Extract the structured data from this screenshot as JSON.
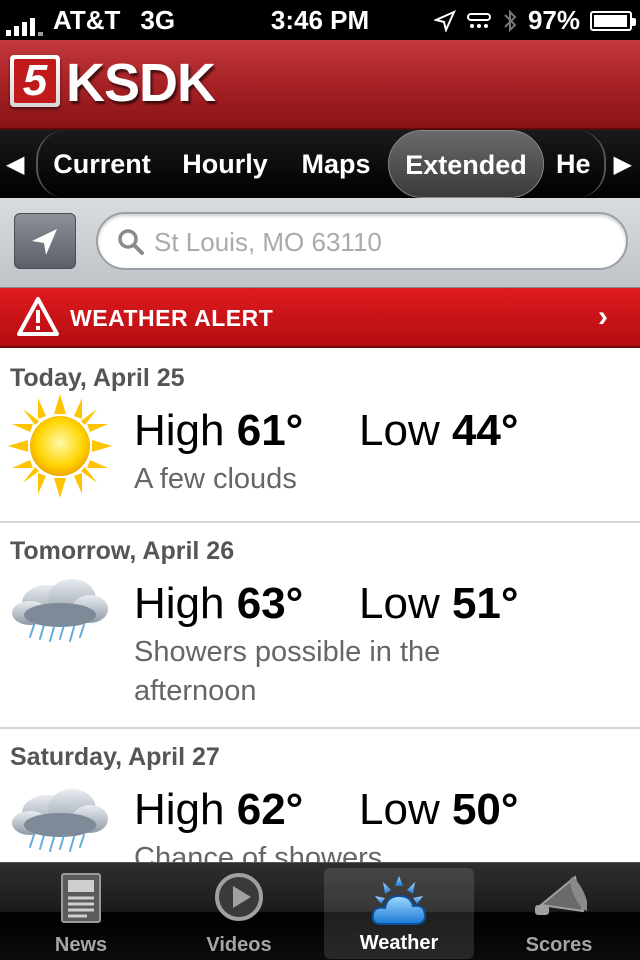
{
  "status_bar": {
    "carrier": "AT&T",
    "network": "3G",
    "time": "3:46 PM",
    "battery": "97%",
    "battery_level": 0.97,
    "icons": [
      "signal-icon",
      "location-arrow-icon",
      "tty-icon",
      "bluetooth-icon",
      "battery-icon"
    ]
  },
  "brand": {
    "logo_number": "5",
    "logo_text": "KSDK",
    "colors": {
      "brand_red": "#a92327",
      "alert_red": "#e01b1f"
    }
  },
  "nav": {
    "tabs": [
      {
        "label": "Current"
      },
      {
        "label": "Hourly"
      },
      {
        "label": "Maps"
      },
      {
        "label": "Extended"
      },
      {
        "label": "He"
      }
    ],
    "active": "Extended",
    "left_arrow": "◀",
    "right_arrow": "▶"
  },
  "search": {
    "placeholder": "St Louis, MO 63110",
    "icon": "search-icon",
    "locate_icon": "location-arrow-icon"
  },
  "alert": {
    "label": "WEATHER ALERT",
    "chevron": "›",
    "icon": "warning-icon"
  },
  "forecast": [
    {
      "date": "Today, April 25",
      "high_label": "High",
      "high": "61°",
      "low_label": "Low",
      "low": "44°",
      "desc": "A few clouds",
      "icon": "sun-icon"
    },
    {
      "date": "Tomorrow, April 26",
      "high_label": "High",
      "high": "63°",
      "low_label": "Low",
      "low": "51°",
      "desc": "Showers possible in the afternoon",
      "icon": "rain-cloud-icon"
    },
    {
      "date": "Saturday, April 27",
      "high_label": "High",
      "high": "62°",
      "low_label": "Low",
      "low": "50°",
      "desc": "Chance of showers",
      "icon": "rain-cloud-icon"
    }
  ],
  "tab_bar": {
    "items": [
      {
        "label": "News",
        "icon": "newspaper-icon"
      },
      {
        "label": "Videos",
        "icon": "play-icon"
      },
      {
        "label": "Weather",
        "icon": "weather-icon"
      },
      {
        "label": "Scores",
        "icon": "megaphone-icon"
      }
    ],
    "active": "Weather"
  }
}
